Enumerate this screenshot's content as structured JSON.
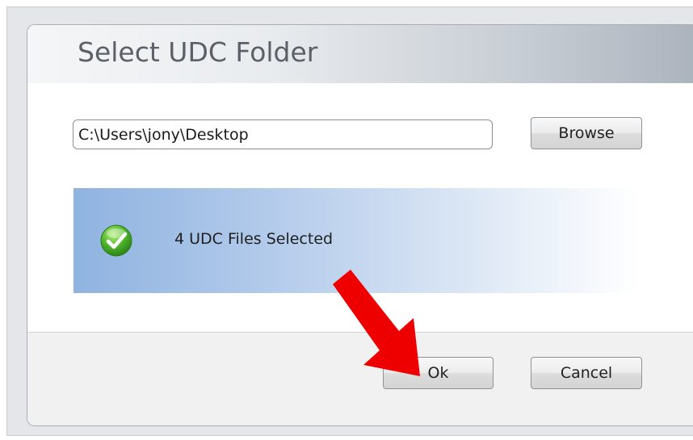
{
  "dialog": {
    "title": "Select UDC Folder"
  },
  "path_field": {
    "value": "C:\\Users\\jony\\Desktop"
  },
  "browse_button": {
    "label": "Browse"
  },
  "status": {
    "text": "4 UDC Files Selected",
    "icon": "checkmark-icon",
    "icon_color": "#3fae2a"
  },
  "footer": {
    "ok_label": "Ok",
    "cancel_label": "Cancel"
  },
  "annotation": {
    "arrow_color": "#ee0000",
    "arrow_icon": "arrow-down-right-icon"
  }
}
